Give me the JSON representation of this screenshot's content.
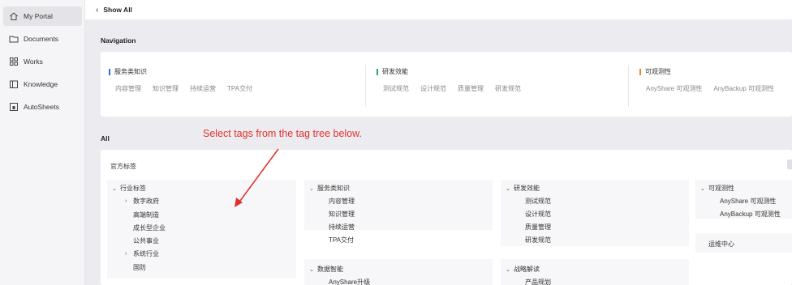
{
  "sidebar": {
    "items": [
      {
        "label": "My Portal",
        "icon": "home-icon",
        "active": true
      },
      {
        "label": "Documents",
        "icon": "folder-icon",
        "active": false
      },
      {
        "label": "Works",
        "icon": "grid-icon",
        "active": false
      },
      {
        "label": "Knowledge",
        "icon": "book-icon",
        "active": false
      },
      {
        "label": "AutoSheets",
        "icon": "sheet-icon",
        "active": false
      }
    ]
  },
  "header": {
    "back_label": "Show All"
  },
  "navigation": {
    "heading": "Navigation",
    "groups": [
      {
        "title": "服务类知识",
        "accent": "#2f6fd8",
        "items": [
          "内容管理",
          "知识管理",
          "持续运营",
          "TPA交付"
        ]
      },
      {
        "title": "研发效能",
        "accent": "#2ba471",
        "items": [
          "测试规范",
          "设计规范",
          "质量管理",
          "研发规范"
        ]
      },
      {
        "title": "可观测性",
        "accent": "#f0862c",
        "items": [
          "AnyShare 可观测性",
          "AnyBackup 可观测性"
        ]
      }
    ]
  },
  "all": {
    "heading": "All",
    "annotation": "Select tags from the tag tree below.",
    "tag_root_label": "官方标签",
    "trees": {
      "industry": {
        "title": "行业标签",
        "children": [
          {
            "label": "数字政府",
            "expandable": true
          },
          {
            "label": "高端制造",
            "expandable": false
          },
          {
            "label": "成长型企业",
            "expandable": false
          },
          {
            "label": "公共事业",
            "expandable": false
          },
          {
            "label": "系统行业",
            "expandable": true
          },
          {
            "label": "国防",
            "expandable": false
          }
        ]
      },
      "service": {
        "title": "服务类知识",
        "children": [
          "内容管理",
          "知识管理",
          "持续运营",
          "TPA交付"
        ]
      },
      "rd": {
        "title": "研发效能",
        "children": [
          "测试规范",
          "设计规范",
          "质量管理",
          "研发规范"
        ]
      },
      "observability": {
        "title": "可观测性",
        "children": [
          "AnyShare 可观测性",
          "AnyBackup 可观测性"
        ]
      },
      "ops_center": {
        "title": "运维中心"
      },
      "data": {
        "title": "数据智能",
        "children": [
          "AnyShare升级"
        ]
      },
      "strategy": {
        "title": "战略解读",
        "children": [
          "产品规划"
        ]
      }
    }
  },
  "colors": {
    "annotation": "#e0302e",
    "sidebar_bg": "#f5f5f7",
    "main_bg": "#ececf0"
  }
}
